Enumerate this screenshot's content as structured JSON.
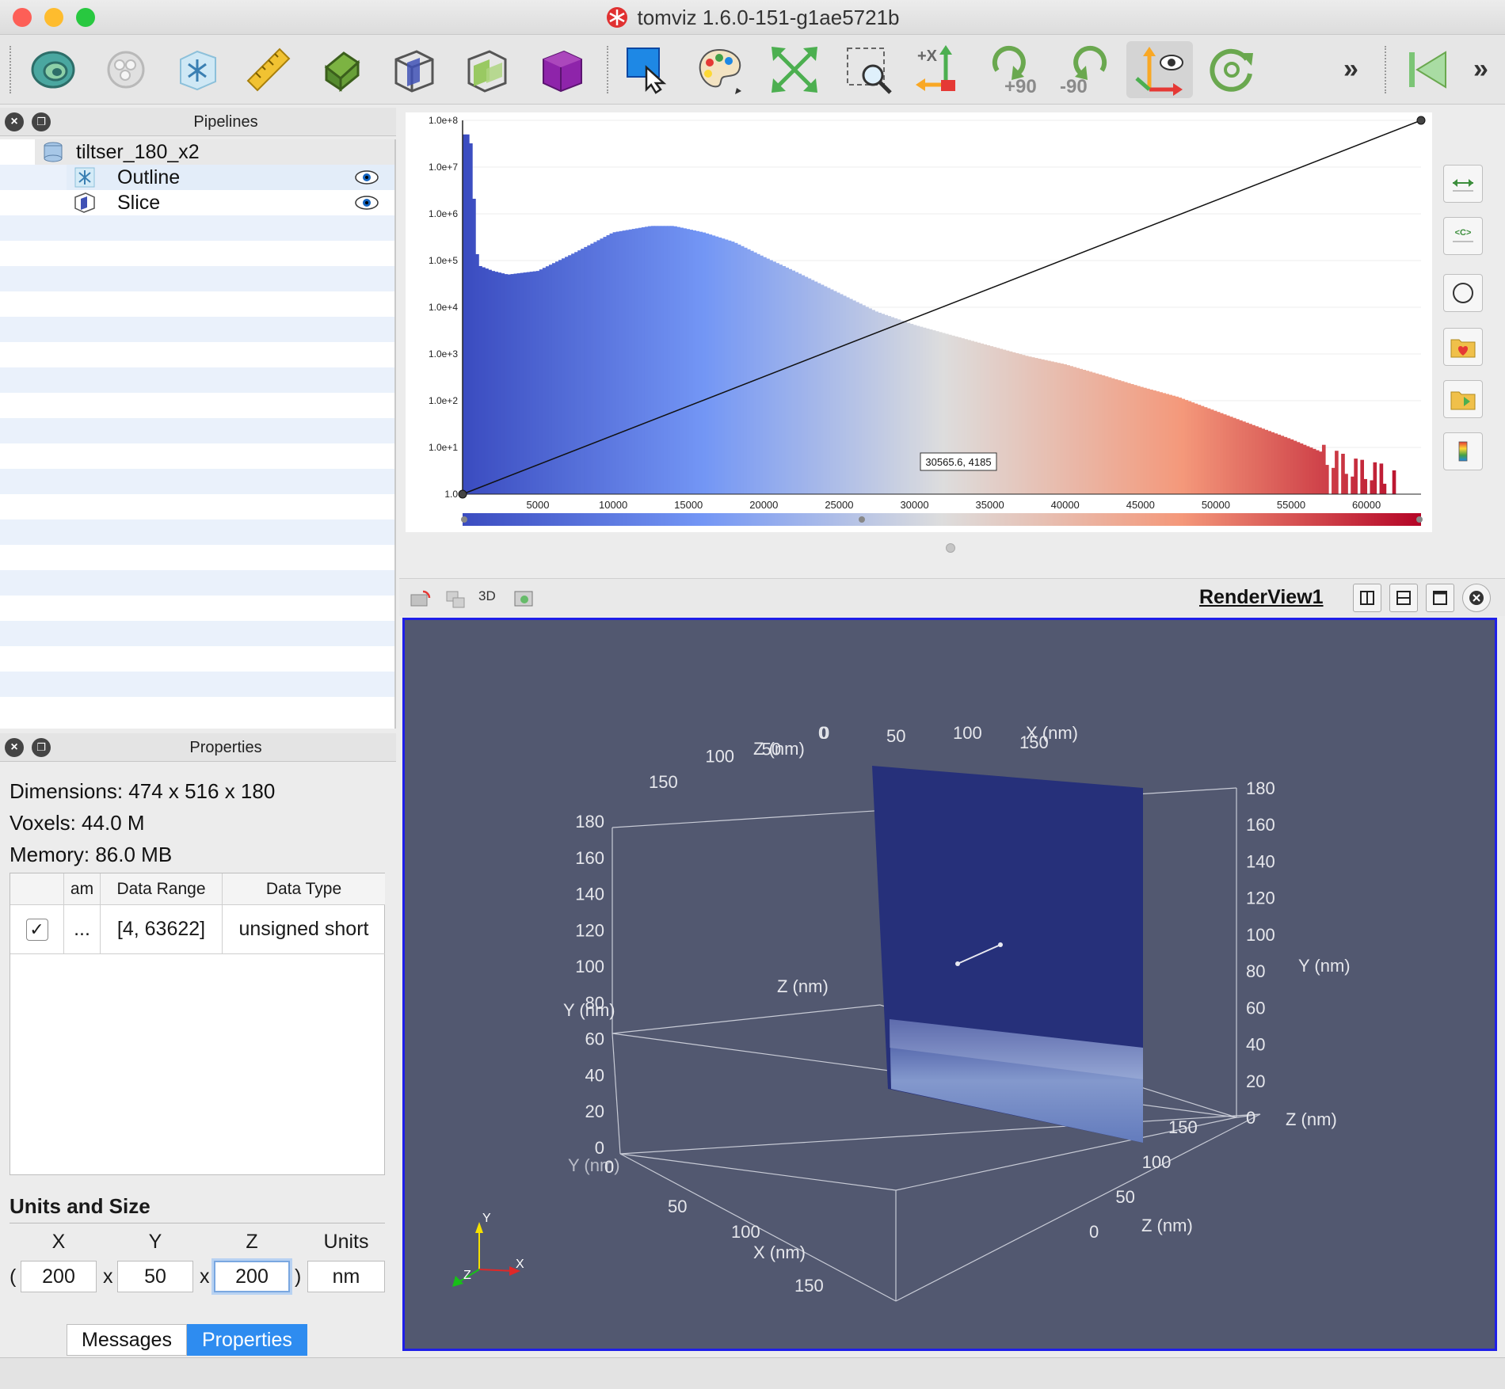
{
  "window": {
    "title": "tomviz 1.6.0-151-g1ae5721b",
    "traffic_colors": [
      "#fd5f57",
      "#febc2e",
      "#28c840"
    ]
  },
  "toolbar": {
    "rotate_plus_label": "+90",
    "rotate_minus_label": "-90",
    "reset_axis_label": "+X",
    "more_label": "»",
    "icons": [
      "contour-icon",
      "segment-icon",
      "outline-icon",
      "ruler-icon",
      "clip-icon",
      "slice-icon",
      "orthogonal-slice-icon",
      "volume-icon",
      "select-icon",
      "palette-icon",
      "reset-camera-icon",
      "zoom-box-icon",
      "axis-icon",
      "rotate-cw-icon",
      "rotate-ccw-icon",
      "interaction-icon",
      "refresh-icon",
      "first-frame-icon"
    ]
  },
  "pipelines": {
    "title": "Pipelines",
    "root": "tiltser_180_x2",
    "children": [
      {
        "label": "Outline"
      },
      {
        "label": "Slice"
      }
    ]
  },
  "properties": {
    "title": "Properties",
    "dimensions": "Dimensions: 474 x 516 x 180",
    "voxels": "Voxels: 44.0 M",
    "memory": "Memory: 86.0 MB",
    "table": {
      "headers": [
        "",
        "am",
        "Data Range",
        "Data Type"
      ],
      "row": {
        "checked": "✓",
        "name": "...",
        "range": "[4, 63622]",
        "type": "unsigned short"
      }
    },
    "units": {
      "title": "Units and Size",
      "headers": {
        "x": "X",
        "y": "Y",
        "z": "Z",
        "units": "Units"
      },
      "open_paren": "(",
      "close_paren": ")",
      "times": "x",
      "x": "200",
      "y": "50",
      "z": "200",
      "unit": "nm"
    }
  },
  "tabs": {
    "messages": "Messages",
    "properties": "Properties"
  },
  "histogram": {
    "tooltip": "30565.6, 4185",
    "y_ticks": [
      "1.0",
      "1.0e+1",
      "1.0e+2",
      "1.0e+3",
      "1.0e+4",
      "1.0e+5",
      "1.0e+6",
      "1.0e+7",
      "1.0e+8"
    ],
    "x_ticks": [
      "5000",
      "10000",
      "15000",
      "20000",
      "25000",
      "30000",
      "35000",
      "40000",
      "45000",
      "50000",
      "55000",
      "60000"
    ],
    "colors": {
      "low": "#3b4cc0",
      "mid": "#dddddd",
      "high": "#b40426"
    }
  },
  "chart_data": {
    "type": "bar",
    "x_range": [
      4,
      63622
    ],
    "y_scale": "log",
    "ylim": [
      1,
      100000000
    ],
    "bins_x": [
      500,
      1000,
      2000,
      3000,
      5000,
      7500,
      10000,
      12500,
      14000,
      16000,
      18000,
      20000,
      22000,
      25000,
      27500,
      30000,
      32500,
      35000,
      37500,
      40000,
      42500,
      45000,
      47500,
      50000,
      52500,
      55000,
      57000,
      59000,
      61000,
      62000
    ],
    "bins_y": [
      50000000,
      80000,
      60000,
      50000,
      60000,
      150000,
      400000,
      550000,
      550000,
      400000,
      250000,
      120000,
      60000,
      20000,
      8000,
      4185,
      2500,
      1500,
      900,
      600,
      350,
      200,
      120,
      60,
      30,
      15,
      8,
      4,
      3,
      2
    ],
    "transfer_line": [
      [
        4,
        1
      ],
      [
        63622,
        100000000
      ]
    ]
  },
  "render_view": {
    "name": "RenderView1",
    "btn_3d": "3D",
    "background": "#525870",
    "axis_labels": {
      "x": "X (nm)",
      "y": "Y (nm)",
      "z": "Z (nm)"
    },
    "orientation": {
      "x": "X",
      "y": "Y",
      "z": "Z"
    },
    "y_ticks": [
      "0",
      "20",
      "40",
      "60",
      "80",
      "100",
      "120",
      "140",
      "160",
      "180"
    ],
    "xz_ticks": [
      "0",
      "50",
      "100",
      "150"
    ]
  }
}
